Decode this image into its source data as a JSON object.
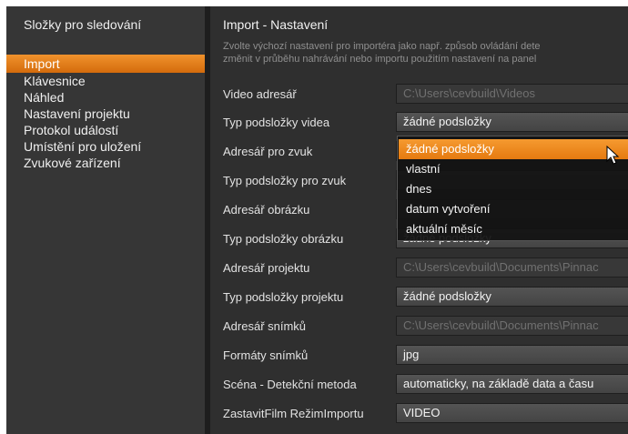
{
  "sidebar": {
    "title": "Složky pro sledování",
    "items": [
      {
        "label": "Import",
        "active": true
      },
      {
        "label": "Klávesnice",
        "active": false
      },
      {
        "label": "Náhled",
        "active": false
      },
      {
        "label": "Nastavení projektu",
        "active": false
      },
      {
        "label": "Protokol událostí",
        "active": false
      },
      {
        "label": "Umístění pro uložení",
        "active": false
      },
      {
        "label": "Zvukové zařízení",
        "active": false
      }
    ]
  },
  "main": {
    "title": "Import - Nastavení",
    "description": [
      "Zvolte výchozí nastavení pro importéra jako např. způsob ovládání dete",
      "změnit v průběhu nahrávání nebo importu použitím nastavení na panel"
    ],
    "settings": [
      {
        "label": "Video adresář",
        "value": "C:\\Users\\cevbuild\\Videos",
        "kind": "path"
      },
      {
        "label": "Typ podsložky videa",
        "value": "žádné podsložky",
        "kind": "select"
      },
      {
        "label": "Adresář pro zvuk",
        "value": "",
        "kind": "path"
      },
      {
        "label": "Typ podsložky pro zvuk",
        "value": "",
        "kind": "select"
      },
      {
        "label": "Adresář obrázku",
        "value": "",
        "kind": "path"
      },
      {
        "label": "Typ podsložky obrázku",
        "value": "žádné podsložky",
        "kind": "select"
      },
      {
        "label": "Adresář projektu",
        "value": "C:\\Users\\cevbuild\\Documents\\Pinnac",
        "kind": "path"
      },
      {
        "label": "Typ podsložky projektu",
        "value": "žádné podsložky",
        "kind": "select"
      },
      {
        "label": "Adresář snímků",
        "value": "C:\\Users\\cevbuild\\Documents\\Pinnac",
        "kind": "path"
      },
      {
        "label": "Formáty snímků",
        "value": "jpg",
        "kind": "select"
      },
      {
        "label": "Scéna - Detekční metoda",
        "value": "automaticky, na základě data a času",
        "kind": "select"
      },
      {
        "label": "ZastavitFilm RežimImportu",
        "value": "VIDEO",
        "kind": "select"
      }
    ]
  },
  "dropdown": {
    "options": [
      "žádné podsložky",
      "vlastní",
      "dnes",
      "datum vytvoření",
      "aktuální měsíc"
    ],
    "selected_index": 0
  },
  "colors": {
    "accent": "#f0922c",
    "background": "#2f2f2f",
    "sidebar": "#363636"
  }
}
